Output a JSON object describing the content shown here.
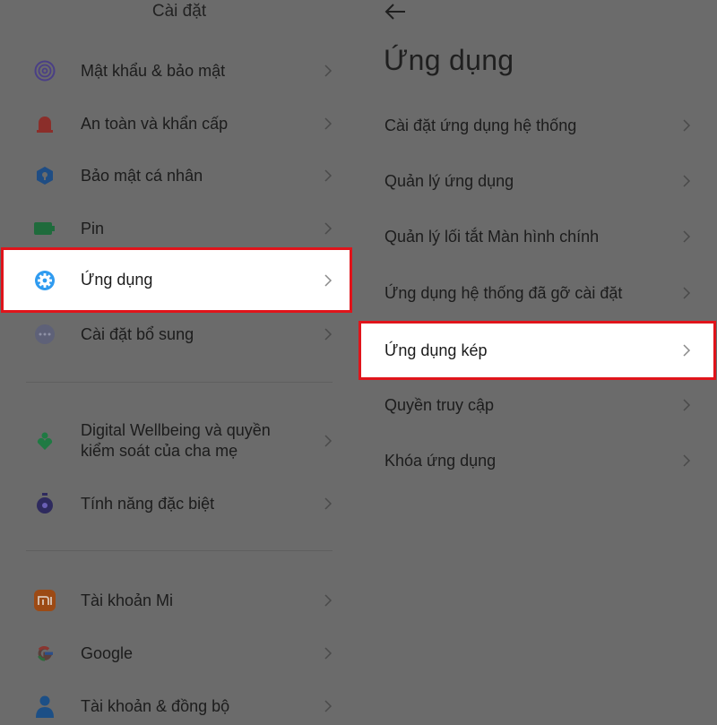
{
  "left": {
    "title": "Cài đặt",
    "items": [
      {
        "label": "Mật khẩu & bảo mật",
        "icon": "fingerprint-icon"
      },
      {
        "label": "An toàn và khẩn cấp",
        "icon": "emergency-icon"
      },
      {
        "label": "Bảo mật cá nhân",
        "icon": "privacy-shield-icon"
      },
      {
        "label": "Pin",
        "icon": "battery-icon"
      },
      {
        "label": "Ứng dụng",
        "icon": "gear-icon",
        "highlighted": true
      },
      {
        "label": "Cài đặt bổ sung",
        "icon": "more-dots-icon"
      },
      {
        "label": "Digital Wellbeing và quyền kiểm soát của cha mẹ",
        "icon": "wellbeing-icon"
      },
      {
        "label": "Tính năng đặc biệt",
        "icon": "stopwatch-icon"
      },
      {
        "label": "Tài khoản Mi",
        "icon": "mi-logo-icon"
      },
      {
        "label": "Google",
        "icon": "google-logo-icon"
      },
      {
        "label": "Tài khoản & đồng bộ",
        "icon": "person-icon"
      }
    ]
  },
  "right": {
    "heading": "Ứng dụng",
    "items": [
      {
        "label": "Cài đặt ứng dụng hệ thống"
      },
      {
        "label": "Quản lý ứng dụng"
      },
      {
        "label": "Quản lý lối tắt Màn hình chính"
      },
      {
        "label": "Ứng dụng hệ thống đã gỡ cài đặt"
      },
      {
        "label": "Ứng dụng kép",
        "highlighted": true
      },
      {
        "label": "Quyền truy cập"
      },
      {
        "label": "Khóa ứng dụng"
      }
    ]
  },
  "colors": {
    "background": "#6b6b6b",
    "highlight_border": "#e0141b",
    "gear_blue": "#2f9bf0"
  }
}
